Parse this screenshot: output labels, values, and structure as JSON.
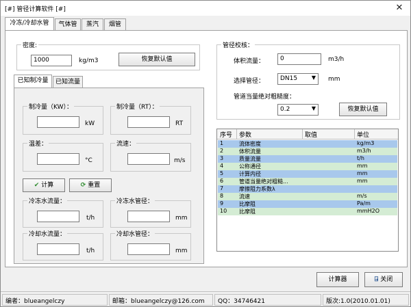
{
  "window": {
    "title": "[#] 管径计算软件 [#]",
    "close_glyph": "✕"
  },
  "tabs": [
    {
      "label": "冷冻/冷却水管"
    },
    {
      "label": "气体管"
    },
    {
      "label": "蒸汽"
    },
    {
      "label": "烟管"
    }
  ],
  "density": {
    "group_title": "密度:",
    "value": "1000",
    "unit": "kg/m3",
    "restore_button": "恢复默认值"
  },
  "inner_tabs": [
    {
      "label": "已知制冷量"
    },
    {
      "label": "已知流量"
    }
  ],
  "calc": {
    "cooling_kw": {
      "label": "制冷量（KW）：",
      "value": "",
      "unit": "kW"
    },
    "cooling_rt": {
      "label": "制冷量（RT）：",
      "value": "",
      "unit": "RT"
    },
    "temp_diff": {
      "label": "温差：",
      "value": "",
      "unit": "°C"
    },
    "velocity": {
      "label": "流速：",
      "value": "",
      "unit": "m/s"
    },
    "calc_button": "计算",
    "reset_button": "重置",
    "chilled_flow": {
      "label": "冷冻水流量：",
      "value": "",
      "unit": "t/h"
    },
    "chilled_dia": {
      "label": "冷冻水管径：",
      "value": "",
      "unit": "mm"
    },
    "cooling_flow": {
      "label": "冷却水流量：",
      "value": "",
      "unit": "t/h"
    },
    "cooling_dia": {
      "label": "冷却水管径：",
      "value": "",
      "unit": "mm"
    }
  },
  "check": {
    "group_title": "管径校核：",
    "flow_label": "体积流量：",
    "flow_value": "0",
    "flow_unit": "m3/h",
    "pipe_label": "选择管径：",
    "pipe_value": "DN15",
    "pipe_unit": "mm",
    "rough_label": "管道当量绝对粗糙度：",
    "rough_value": "0.2",
    "restore_button": "恢复默认值"
  },
  "table": {
    "headers": [
      "序号",
      "参数",
      "取值",
      "单位"
    ],
    "rows": [
      {
        "no": "1",
        "param": "流体密度",
        "value": "",
        "unit": "kg/m3"
      },
      {
        "no": "2",
        "param": "体积流量",
        "value": "",
        "unit": "m3/h"
      },
      {
        "no": "3",
        "param": "质量流量",
        "value": "",
        "unit": "t/h"
      },
      {
        "no": "4",
        "param": "公称通径",
        "value": "",
        "unit": "mm"
      },
      {
        "no": "5",
        "param": "计算内径",
        "value": "",
        "unit": "mm"
      },
      {
        "no": "6",
        "param": "管道当量绝对粗糙...",
        "value": "",
        "unit": "mm"
      },
      {
        "no": "7",
        "param": "摩擦阻力系数λ",
        "value": "",
        "unit": ""
      },
      {
        "no": "8",
        "param": "流速",
        "value": "",
        "unit": "m/s"
      },
      {
        "no": "9",
        "param": "比摩阻",
        "value": "",
        "unit": "Pa/m"
      },
      {
        "no": "10",
        "param": "比摩阻",
        "value": "",
        "unit": "mmH2O"
      }
    ]
  },
  "bottom": {
    "calculator_button": "计算器",
    "close_button": "关闭"
  },
  "status": {
    "author": "编者：blueangelczy",
    "email": "邮箱：blueangelczy@126.com",
    "qq": "QQ：34746421",
    "version": "版次:1.0(2010.01.01)"
  },
  "colors": {
    "row_blue": "#a8c8ec",
    "row_green": "#d4ecd4",
    "accent_green": "#2e8b2e"
  }
}
